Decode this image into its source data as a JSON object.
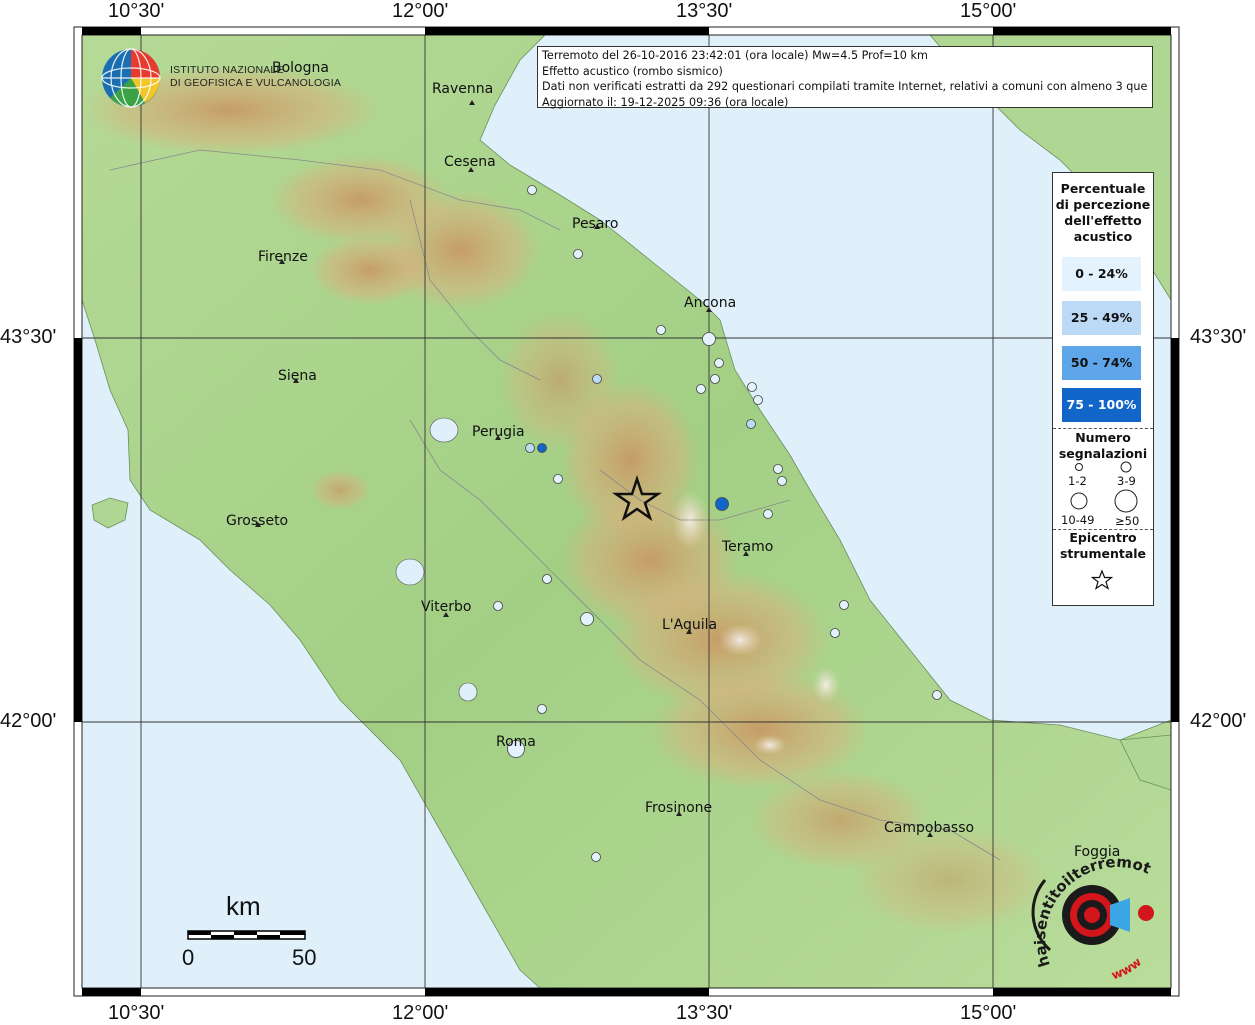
{
  "axes": {
    "top": [
      "10°30'",
      "12°00'",
      "13°30'",
      "15°00'"
    ],
    "bottom": [
      "10°30'",
      "12°00'",
      "13°30'",
      "15°00'"
    ],
    "left": [
      "43°30'",
      "42°00'"
    ],
    "right": [
      "43°30'",
      "42°00'"
    ]
  },
  "institute": {
    "name_line1": "ISTITUTO NAZIONALE",
    "name_line2": "DI GEOFISICA E VULCANOLOGIA"
  },
  "info": {
    "line1": "Terremoto del 26-10-2016 23:42:01 (ora locale) Mw=4.5 Prof=10 km",
    "line2": "Effetto acustico (rombo sismico)",
    "line3": "Dati non verificati estratti da 292 questionari compilati tramite Internet, relativi a comuni con almeno 3 questionari.",
    "line4": "Aggiornato il: 19-12-2025 09:36 (ora locale)"
  },
  "cities": {
    "bologna": "Bologna",
    "ravenna": "Ravenna",
    "cesena": "Cesena",
    "pesaro": "Pesaro",
    "firenze": "Firenze",
    "ancona": "Ancona",
    "siena": "Siena",
    "perugia": "Perugia",
    "grosseto": "Grosseto",
    "teramo": "Teramo",
    "viterbo": "Viterbo",
    "laquila": "L'Aquila",
    "roma": "Roma",
    "frosinone": "Frosinone",
    "campobasso": "Campobasso",
    "foggia": "Foggia"
  },
  "legend": {
    "title1": "Percentuale",
    "title2": "di percezione",
    "title3": "dell'effetto",
    "title4": "acustico",
    "classes": [
      {
        "label": "0 - 24%",
        "color": "#e3f2fc"
      },
      {
        "label": "25 - 49%",
        "color": "#bcdaf5"
      },
      {
        "label": "50 - 74%",
        "color": "#5fa5ea"
      },
      {
        "label": "75 - 100%",
        "color": "#1266c9"
      }
    ],
    "count_title1": "Numero",
    "count_title2": "segnalazioni",
    "count_labels": [
      "1-2",
      "3-9",
      "10-49",
      "≥50"
    ],
    "epicenter_title1": "Epicentro",
    "epicenter_title2": "strumentale"
  },
  "scale": {
    "unit": "km",
    "min": "0",
    "max": "50"
  },
  "watermark": {
    "text": "haisentitoilterremoto.it",
    "url": "www.",
    "accent": "#d3151c"
  },
  "colors": {
    "sea": "#dff0fb",
    "land": "#a6d28a",
    "relief": "#c8a06a",
    "grid": "#333333"
  }
}
